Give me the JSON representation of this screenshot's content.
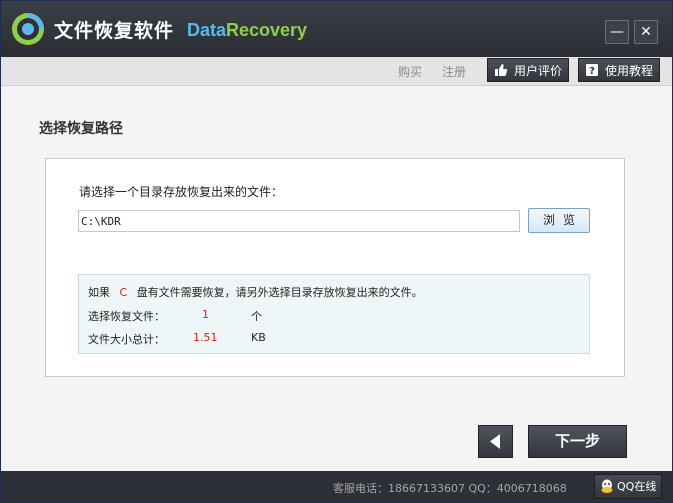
{
  "window": {
    "title": "文件恢复软件",
    "brand_data": "Data",
    "brand_recovery": "Recovery",
    "minimize_glyph": "—",
    "close_glyph": "✕"
  },
  "toolbar": {
    "buy": "购买",
    "register": "注册",
    "user_review": "用户评价",
    "tutorial": "使用教程"
  },
  "section": {
    "title": "选择恢复路径"
  },
  "path": {
    "prompt": "请选择一个目录存放恢复出来的文件：",
    "value": "C:\\KDR",
    "browse": "浏览"
  },
  "info": {
    "line1_pre": "如果",
    "drive": "C",
    "line1_post": "盘有文件需要恢复，请另外选择目录存放恢复出来的文件。",
    "files_label": "选择恢复文件：",
    "files_count": "1",
    "files_unit": "个",
    "size_label": "文件大小总计：",
    "size_value": "1.51",
    "size_unit": "KB"
  },
  "nav": {
    "next": "下一步"
  },
  "status": {
    "contact": "客服电话：18667133607 QQ：4006718068",
    "qq": "QQ在线"
  },
  "colors": {
    "accent_blue": "#5db8e6",
    "accent_green": "#8ecf4b",
    "highlight_red": "#cc2222"
  }
}
